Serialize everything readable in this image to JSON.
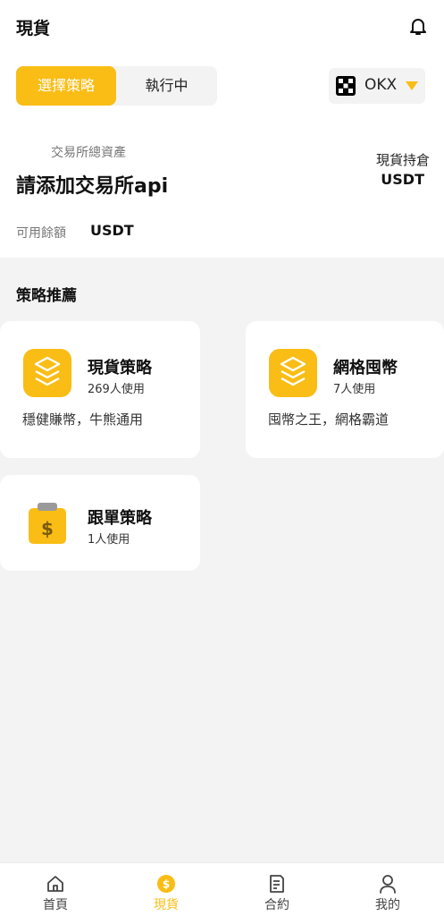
{
  "header": {
    "title": "現貨"
  },
  "tabs": [
    {
      "label": "選擇策略"
    },
    {
      "label": "執行中"
    }
  ],
  "exchange": {
    "name": "OKX"
  },
  "account": {
    "assets_label": "交易所總資產",
    "add_api_prompt": "請添加交易所api",
    "holding_label": "現貨持倉",
    "holding_unit": "USDT",
    "available_label": "可用餘額",
    "available_unit": "USDT"
  },
  "recommend": {
    "title": "策略推薦",
    "strategies": [
      {
        "name": "現貨策略",
        "users": "269人使用",
        "desc": "穩健賺幣，牛熊通用",
        "icon": "layers-icon"
      },
      {
        "name": "網格囤幣",
        "users": "7人使用",
        "desc": "囤幣之王，網格霸道",
        "icon": "layers-icon"
      },
      {
        "name": "跟單策略",
        "users": "1人使用",
        "icon": "dollar-bag-icon"
      }
    ]
  },
  "bottom_nav": [
    {
      "label": "首頁",
      "icon": "home-icon"
    },
    {
      "label": "現貨",
      "icon": "coin-icon"
    },
    {
      "label": "合約",
      "icon": "document-icon"
    },
    {
      "label": "我的",
      "icon": "user-icon"
    }
  ],
  "colors": {
    "accent": "#f9bd16",
    "background": "#f3f3f3"
  }
}
